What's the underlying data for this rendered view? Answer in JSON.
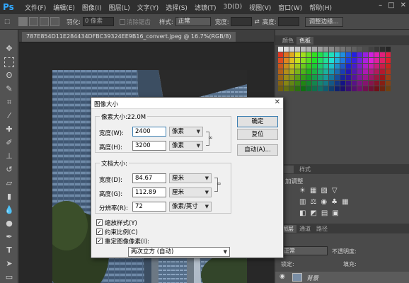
{
  "app": {
    "logo": "Ps"
  },
  "menu": [
    "文件(F)",
    "编辑(E)",
    "图像(I)",
    "图层(L)",
    "文字(Y)",
    "选择(S)",
    "滤镜(T)",
    "3D(D)",
    "视图(V)",
    "窗口(W)",
    "帮助(H)"
  ],
  "options_bar": {
    "feather_label": "羽化:",
    "feather_value": "0 像素",
    "antialias_label": "消除锯齿",
    "style_label": "样式:",
    "style_value": "正常",
    "width_label": "宽度:",
    "height_label": "高度:",
    "refine_button": "调整边缘..."
  },
  "document": {
    "tab_title": "787E854D11E284434DFBC39324EE9B16_convert.jpeg @ 16.7%(RGB/8)"
  },
  "panels": {
    "color_tab": "颜色",
    "swatches_tab": "色板",
    "style_tab": "样式",
    "adjust_label": "加调整",
    "layers_tab": "图层",
    "channels_tab": "通道",
    "paths_tab": "路径",
    "blend_mode": "正常",
    "opacity_label": "不透明度:",
    "lock_label": "锁定:",
    "fill_label": "填充:",
    "layer_name": "背景"
  },
  "dialog": {
    "title": "图像大小",
    "pixel_dims_title": "像素大小:22.0M",
    "px_width_label": "宽度(W):",
    "px_width_value": "2400",
    "px_width_unit": "像素",
    "px_height_label": "高度(H):",
    "px_height_value": "3200",
    "px_height_unit": "像素",
    "doc_size_title": "文档大小:",
    "doc_width_label": "宽度(D):",
    "doc_width_value": "84.67",
    "doc_width_unit": "厘米",
    "doc_height_label": "高度(G):",
    "doc_height_value": "112.89",
    "doc_height_unit": "厘米",
    "resolution_label": "分辨率(R):",
    "resolution_value": "72",
    "resolution_unit": "像素/英寸",
    "scale_styles": "缩放样式(Y)",
    "constrain": "约束比例(C)",
    "resample": "重定图像像素(I):",
    "resample_method": "两次立方 (自动)",
    "ok": "确定",
    "reset": "复位",
    "auto": "自动(A)..."
  },
  "colors": {
    "accent": "#31a8ff",
    "dialog_bg": "#f0f0f0"
  }
}
